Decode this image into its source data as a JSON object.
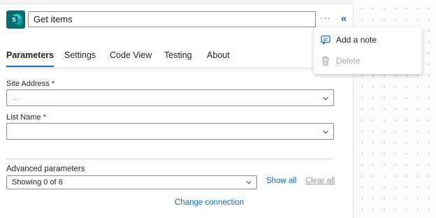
{
  "header": {
    "title": "Get items",
    "more_label": "···",
    "collapse_label": "«"
  },
  "tabs": [
    {
      "label": "Parameters",
      "active": true
    },
    {
      "label": "Settings",
      "active": false
    },
    {
      "label": "Code View",
      "active": false
    },
    {
      "label": "Testing",
      "active": false
    },
    {
      "label": "About",
      "active": false
    }
  ],
  "fields": {
    "site_address": {
      "label": "Site Address *",
      "value": "..."
    },
    "list_name": {
      "label": "List Name *",
      "value": ""
    }
  },
  "advanced": {
    "label": "Advanced parameters",
    "dropdown_value": "Showing 0 of 6",
    "show_all": "Show all",
    "clear_all": "Clear all"
  },
  "footer": {
    "change_connection": "Change connection"
  },
  "context_menu": {
    "items": [
      {
        "label": "Add a note",
        "icon": "note-icon",
        "enabled": true
      },
      {
        "label": "Delete",
        "icon": "trash-icon",
        "enabled": false
      }
    ],
    "highlight_color": "#fbfb3a"
  },
  "colors": {
    "accent": "#0f6cbd",
    "sharepoint": "#036c70"
  }
}
